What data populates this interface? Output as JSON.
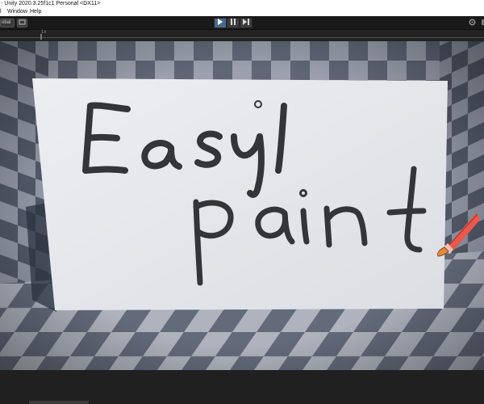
{
  "window": {
    "title": "- Unity 2020.3.25f1c1 Personal <DX11>"
  },
  "menu": {
    "cut_item": "l",
    "items": [
      "Window",
      "Help"
    ]
  },
  "toolbar": {
    "left_label": "obal",
    "play_icon": "play-icon",
    "pause_icon": "pause-icon",
    "step_icon": "step-icon",
    "right_icons": [
      "settings-icon",
      "layout-icon"
    ]
  },
  "game_view": {
    "scale_label": "1x"
  },
  "canvas": {
    "line1": "Easy",
    "line2": "paint",
    "ink_color": "#333538",
    "board_color": "#e8e9ed",
    "brush_icon": "paintbrush-icon",
    "brush_colors": {
      "handle": "#e8584c",
      "ferrule": "#f0c2b0",
      "bristles": "#e28a3a"
    }
  }
}
